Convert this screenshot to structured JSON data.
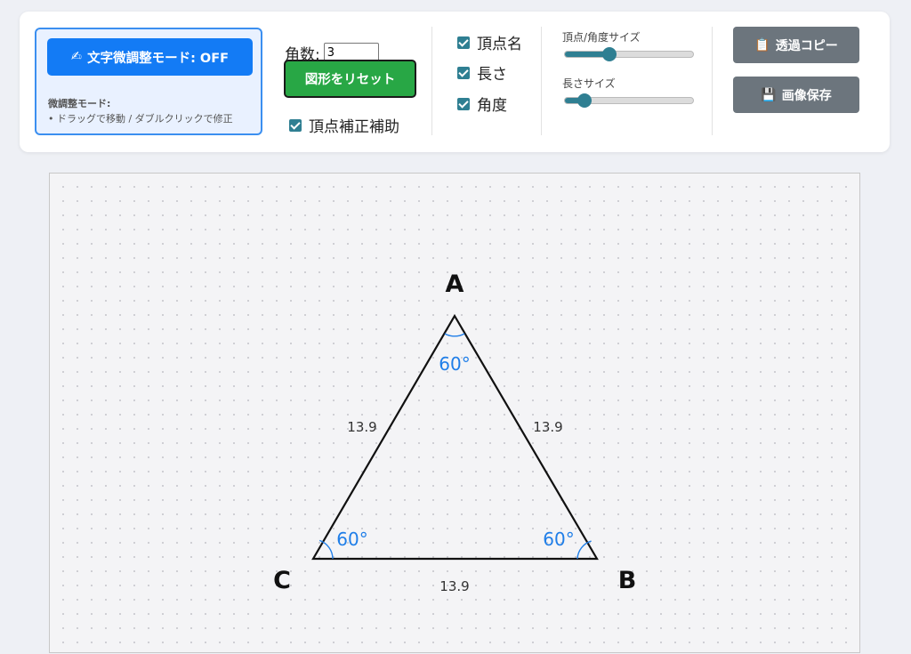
{
  "mode": {
    "button_icon": "✍",
    "button_label": "文字微調整モード: OFF",
    "info_title": "微調整モード:",
    "info_desc": "• ドラッグで移動 / ダブルクリックで修正"
  },
  "angle_count": {
    "label": "角数:",
    "value": "3"
  },
  "reset_button": {
    "label": "図形をリセット"
  },
  "vertex_assist": {
    "label": "頂点補正補助",
    "checked": true
  },
  "display_options": [
    {
      "label": "頂点名",
      "checked": true
    },
    {
      "label": "長さ",
      "checked": true
    },
    {
      "label": "角度",
      "checked": true
    }
  ],
  "sliders": {
    "vertex_angle_size": {
      "label": "頂点/角度サイズ",
      "fraction": 0.35
    },
    "length_size": {
      "label": "長さサイズ",
      "fraction": 0.15
    }
  },
  "actions": {
    "copy": {
      "icon": "clipboard-icon",
      "glyph": "📋",
      "label": "透過コピー"
    },
    "save": {
      "icon": "floppy-disk-icon",
      "glyph": "💾",
      "label": "画像保存"
    }
  },
  "colors": {
    "mode_button": "#137bf5",
    "reset_button": "#28a745",
    "gray_button": "#6c757d",
    "checkbox": "#2f7f92",
    "angle_text": "#1f7ee8"
  },
  "shape": {
    "vertices": [
      {
        "name": "A",
        "angle": "60°"
      },
      {
        "name": "B",
        "angle": "60°"
      },
      {
        "name": "C",
        "angle": "60°"
      }
    ],
    "sides": [
      {
        "between": "A-C",
        "length": "13.9"
      },
      {
        "between": "A-B",
        "length": "13.9"
      },
      {
        "between": "C-B",
        "length": "13.9"
      }
    ]
  }
}
